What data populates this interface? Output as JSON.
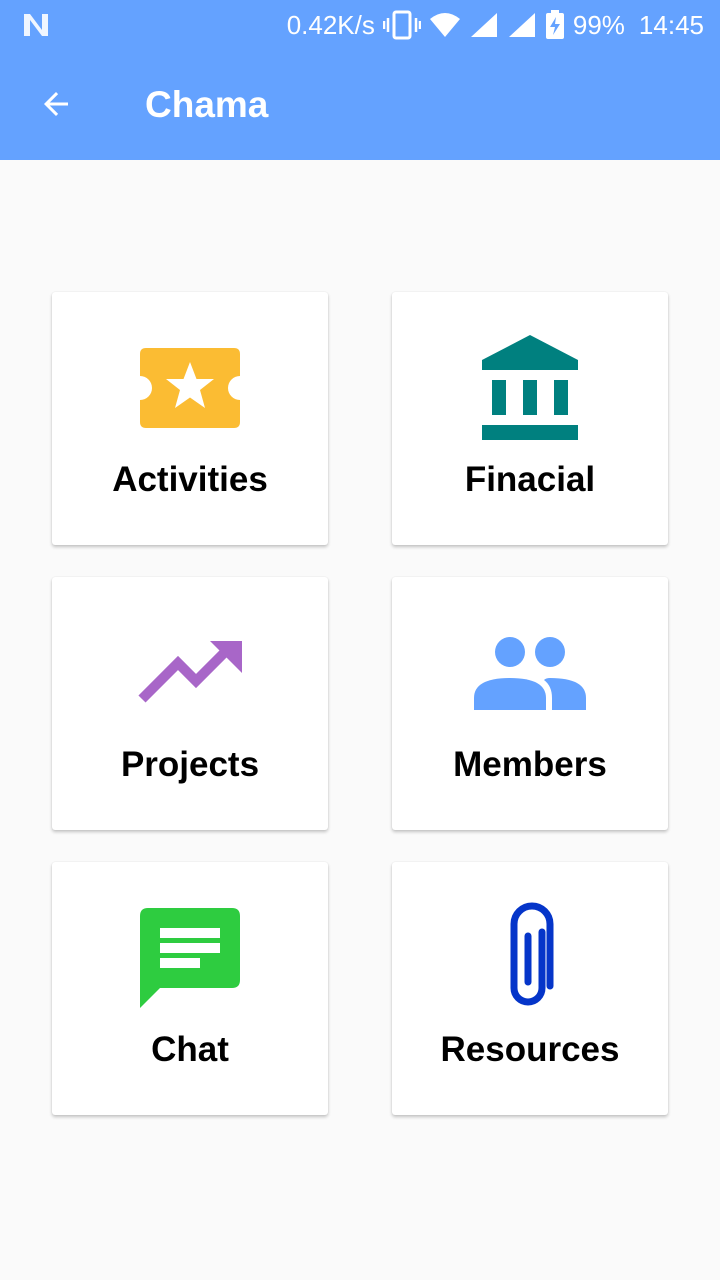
{
  "status_bar": {
    "speed": "0.42K/s",
    "battery": "99%",
    "time": "14:45"
  },
  "toolbar": {
    "title": "Chama",
    "back_icon": "arrow-back-icon"
  },
  "theme": {
    "primary": "#64a2ff",
    "background": "#fafafa"
  },
  "menu": {
    "items": [
      {
        "label": "Activities",
        "icon": "ticket-star-icon",
        "color": "#fbbc33"
      },
      {
        "label": "Finacial",
        "icon": "bank-icon",
        "color": "#00807f"
      },
      {
        "label": "Projects",
        "icon": "trending-up-icon",
        "color": "#a866c8"
      },
      {
        "label": "Members",
        "icon": "people-icon",
        "color": "#64a2ff"
      },
      {
        "label": "Chat",
        "icon": "chat-icon",
        "color": "#2ecc40"
      },
      {
        "label": "Resources",
        "icon": "paperclip-icon",
        "color": "#0535c9"
      }
    ]
  }
}
